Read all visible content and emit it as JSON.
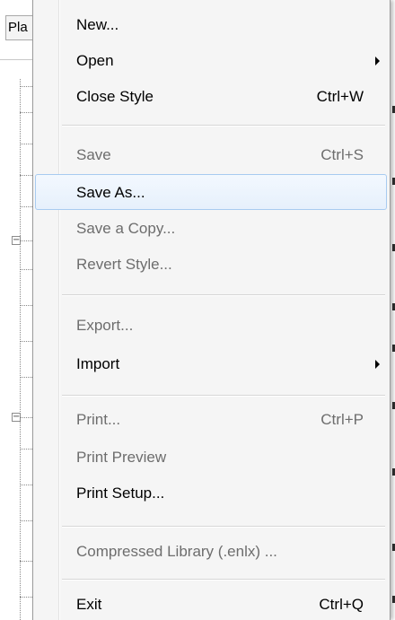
{
  "background": {
    "tab_label": "Pla"
  },
  "menu": {
    "items": [
      {
        "label": "New...",
        "shortcut": "",
        "enabled": true,
        "submenu": false
      },
      {
        "label": "Open",
        "shortcut": "",
        "enabled": true,
        "submenu": true
      },
      {
        "label": "Close Style",
        "shortcut": "Ctrl+W",
        "enabled": true,
        "submenu": false
      },
      {
        "label": "Save",
        "shortcut": "Ctrl+S",
        "enabled": false,
        "submenu": false
      },
      {
        "label": "Save As...",
        "shortcut": "",
        "enabled": true,
        "submenu": false,
        "highlighted": true
      },
      {
        "label": "Save a Copy...",
        "shortcut": "",
        "enabled": false,
        "submenu": false
      },
      {
        "label": "Revert Style...",
        "shortcut": "",
        "enabled": false,
        "submenu": false
      },
      {
        "label": "Export...",
        "shortcut": "",
        "enabled": false,
        "submenu": false
      },
      {
        "label": "Import",
        "shortcut": "",
        "enabled": true,
        "submenu": true
      },
      {
        "label": "Print...",
        "shortcut": "Ctrl+P",
        "enabled": false,
        "submenu": false
      },
      {
        "label": "Print Preview",
        "shortcut": "",
        "enabled": false,
        "submenu": false
      },
      {
        "label": "Print Setup...",
        "shortcut": "",
        "enabled": true,
        "submenu": false
      },
      {
        "label": "Compressed Library (.enlx) ...",
        "shortcut": "",
        "enabled": false,
        "submenu": false
      },
      {
        "label": "Exit",
        "shortcut": "Ctrl+Q",
        "enabled": true,
        "submenu": false
      }
    ]
  },
  "colors": {
    "menu_background": "#f5f5f5",
    "highlight_fill": "#e6f0fc",
    "highlight_border": "#a8cbf0",
    "disabled_text": "#6d6d6d"
  },
  "icons": {
    "submenu_arrow": "chevron-right-icon",
    "tree_toggle": "collapse-minus-icon"
  }
}
